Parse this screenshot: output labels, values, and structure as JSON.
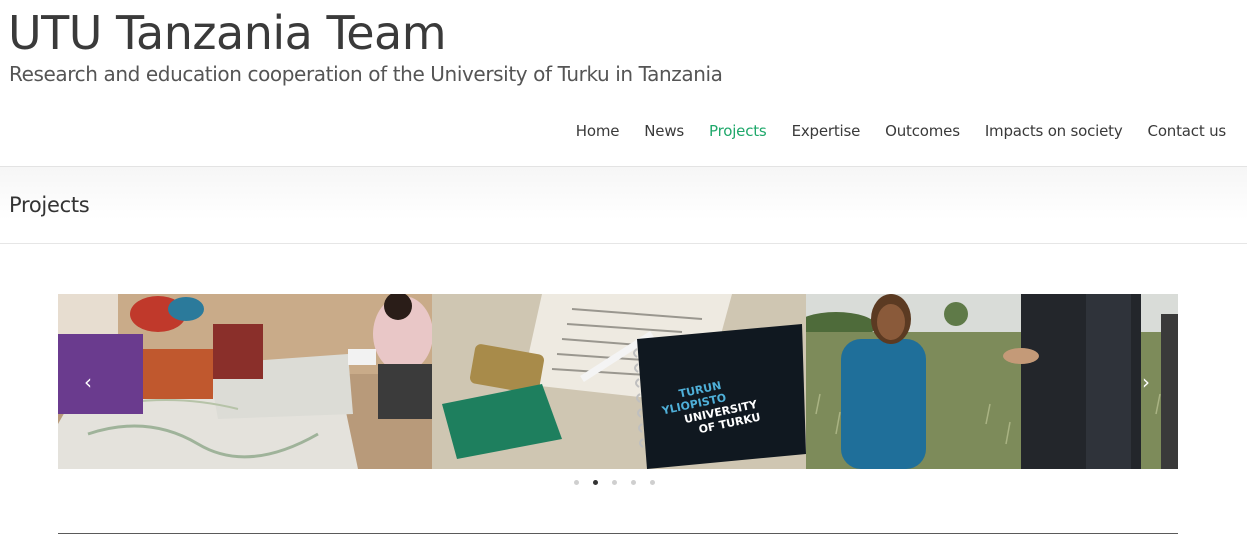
{
  "site": {
    "title": "UTU Tanzania Team",
    "tagline": "Research and education cooperation of the University of Turku in Tanzania"
  },
  "nav": {
    "items": [
      {
        "label": "Home"
      },
      {
        "label": "News"
      },
      {
        "label": "Projects",
        "active": true
      },
      {
        "label": "Expertise"
      },
      {
        "label": "Outcomes"
      },
      {
        "label": "Impacts on society"
      },
      {
        "label": "Contact us"
      }
    ],
    "active_color": "#1fa86b"
  },
  "page": {
    "title": "Projects"
  },
  "carousel": {
    "prev_icon": "chevron-left-icon",
    "next_icon": "chevron-right-icon",
    "prev_glyph": "‹",
    "next_glyph": "›",
    "dot_count": 5,
    "active_dot": 1,
    "notebook_text": [
      "TURUN",
      "YLIOPISTO",
      "UNIVERSITY",
      "OF TURKU"
    ]
  }
}
